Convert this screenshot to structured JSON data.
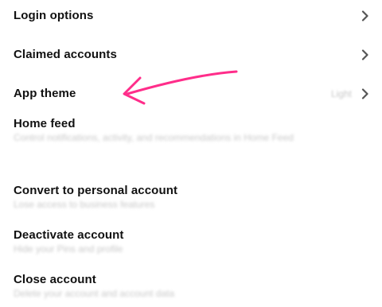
{
  "settings": {
    "login_options": {
      "label": "Login options"
    },
    "claimed_accounts": {
      "label": "Claimed accounts"
    },
    "app_theme": {
      "label": "App theme",
      "value": "Light"
    },
    "home_feed": {
      "label": "Home feed",
      "subtitle": "Control notifications, activity, and recommendations in Home Feed"
    },
    "convert_account": {
      "label": "Convert to personal account",
      "subtitle": "Lose access to business features"
    },
    "deactivate_account": {
      "label": "Deactivate account",
      "subtitle": "Hide your Pins and profile"
    },
    "close_account": {
      "label": "Close account",
      "subtitle": "Delete your account and account data"
    }
  },
  "colors": {
    "annotation_arrow": "#ff2d8a",
    "chevron": "#555555",
    "muted_text": "#c9c9c9"
  },
  "icons": {
    "chevron": "chevron-right-icon",
    "annotation": "arrow-annotation"
  }
}
